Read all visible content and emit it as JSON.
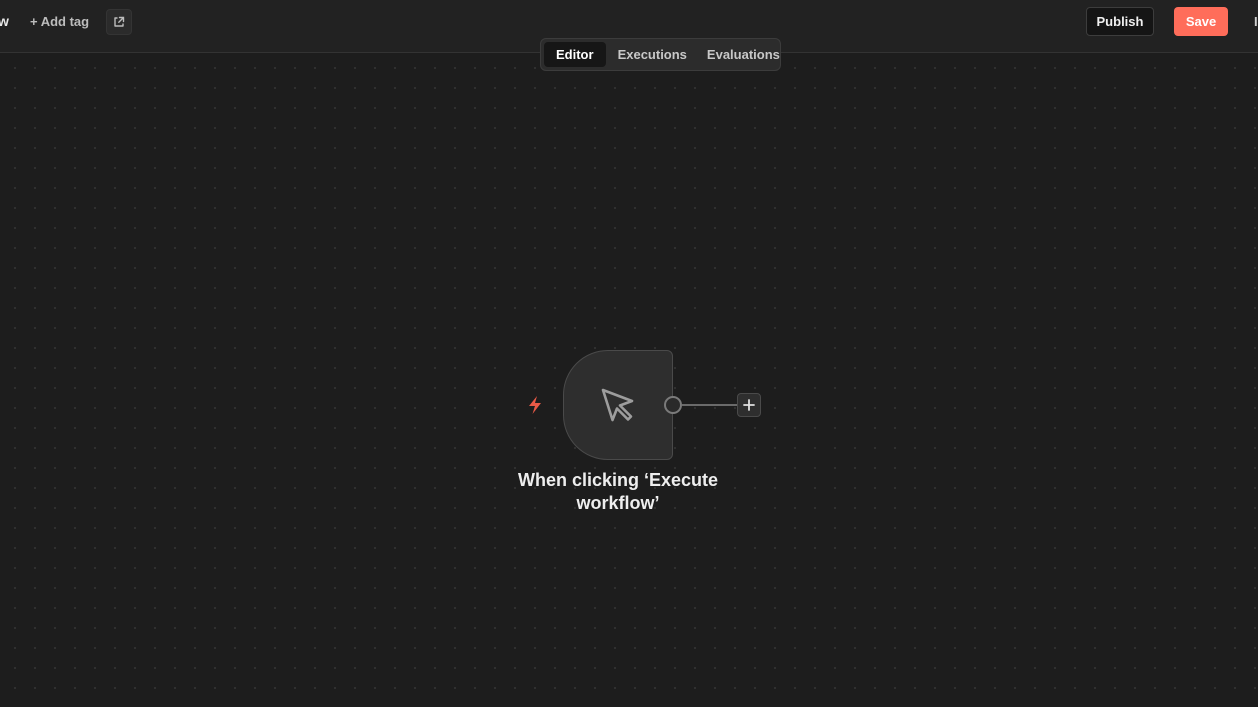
{
  "header": {
    "title_fragment": "w",
    "add_tag_label": "+ Add tag",
    "publish_label": "Publish",
    "save_label": "Save",
    "edge_fragment": "I"
  },
  "tabs": [
    {
      "label": "Editor",
      "active": true
    },
    {
      "label": "Executions",
      "active": false
    },
    {
      "label": "Evaluations",
      "active": false
    }
  ],
  "node": {
    "icon": "mouse-pointer-icon",
    "trigger_icon": "lightning-bolt-icon",
    "label": "When clicking ‘Execute workflow’"
  },
  "colors": {
    "accent": "#ff6d5a",
    "canvas_bg": "#1d1d1d",
    "header_bg": "#222222",
    "node_bg": "#2e2e2e"
  }
}
